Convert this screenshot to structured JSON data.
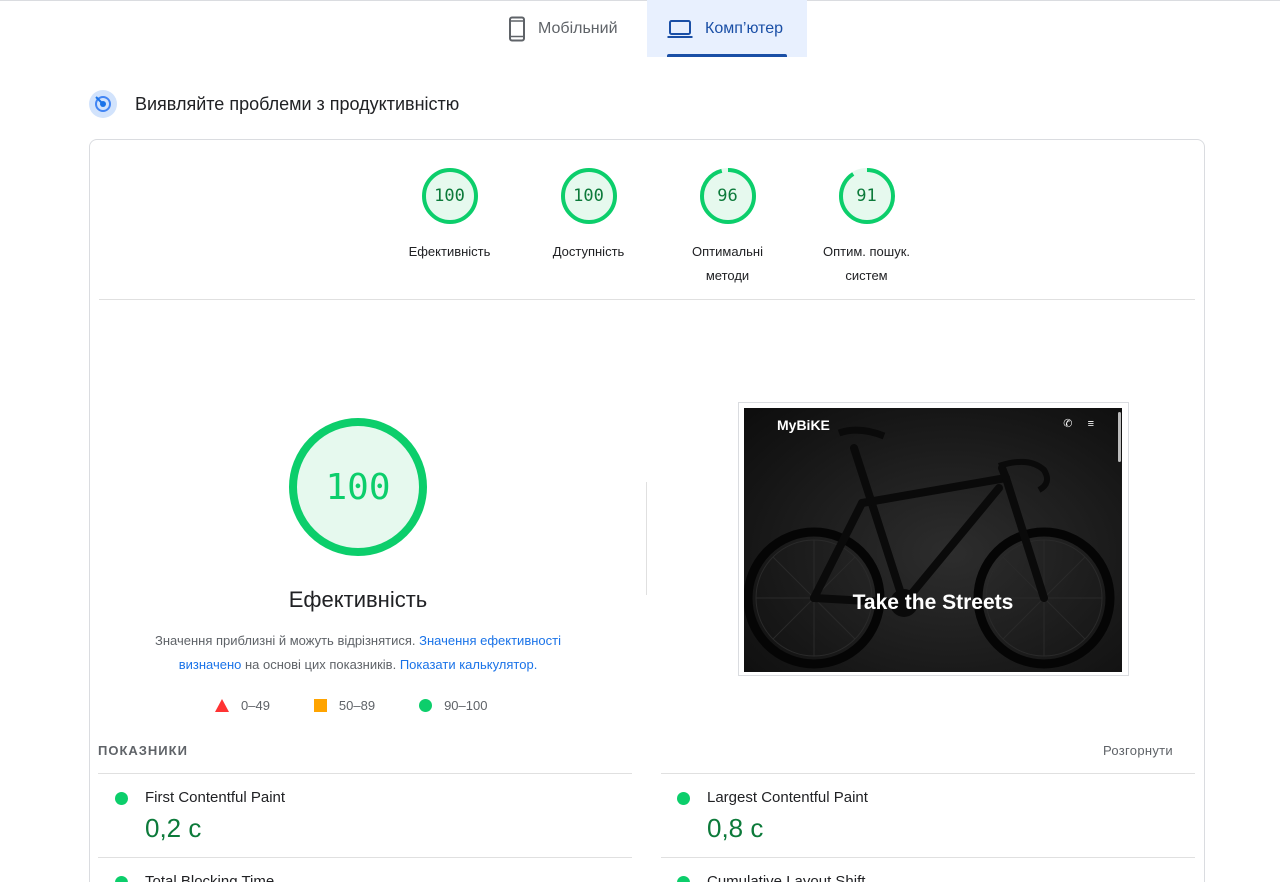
{
  "tabs": [
    {
      "label": "Мобільний",
      "icon": "smartphone-icon",
      "active": false
    },
    {
      "label": "Комп’ютер",
      "icon": "laptop-icon",
      "active": true
    }
  ],
  "section": {
    "title": "Виявляйте проблеми з продуктивністю",
    "icon": "performance-target-icon"
  },
  "gauges": [
    {
      "score": "100",
      "label": "Ефективність"
    },
    {
      "score": "100",
      "label": "Доступність"
    },
    {
      "score": "96",
      "label": "Оптимальні методи"
    },
    {
      "score": "91",
      "label": "Оптим. пошук. систем"
    }
  ],
  "main_gauge": {
    "score": "100",
    "label": "Ефективність"
  },
  "description": {
    "text1": "Значення приблизні й можуть відрізнятися.",
    "link1": "Значення ефективності визначено",
    "text2": "на основі цих показників.",
    "link2": "Показати калькулятор."
  },
  "legend": [
    {
      "range": "0–49",
      "icon": "red-triangle-icon"
    },
    {
      "range": "50–89",
      "icon": "orange-square-icon"
    },
    {
      "range": "90–100",
      "icon": "green-circle-icon"
    }
  ],
  "screenshot": {
    "brand": "MyBiKE",
    "nav_icons": "✆ ≡",
    "hero_text": "Take the Streets"
  },
  "metrics": {
    "heading": "ПОКАЗНИКИ",
    "expand_label": "Розгорнути",
    "items": [
      {
        "name": "First Contentful Paint",
        "value": "0,2 с"
      },
      {
        "name": "Largest Contentful Paint",
        "value": "0,8 с"
      },
      {
        "name": "Total Blocking Time",
        "value": ""
      },
      {
        "name": "Cumulative Layout Shift",
        "value": ""
      }
    ]
  },
  "colors": {
    "pass": "#0cce6b",
    "pass_text": "#0c7a3a",
    "average": "#ffa400",
    "fail": "#ff3333",
    "link": "#1a73e8",
    "tab_active": "#1a4fa6"
  }
}
